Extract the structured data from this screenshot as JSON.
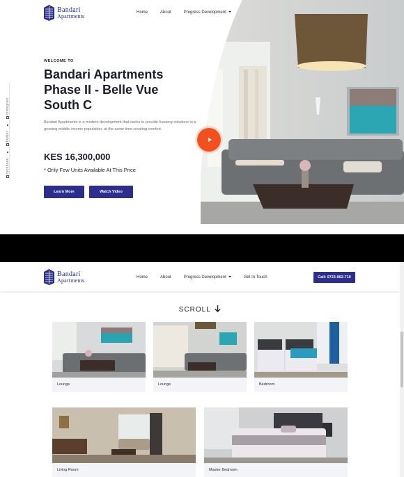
{
  "brand": {
    "line1": "Bandari",
    "line2": "Apartments"
  },
  "nav": {
    "home": "Home",
    "about": "About",
    "progress": "Progress Development",
    "contact": "Get In Touch",
    "call": "Call: 0723-962-710"
  },
  "social": {
    "instagram": "instagram",
    "twitter": "twitter",
    "facebook": "facebook"
  },
  "hero": {
    "welcome": "WELCOME TO",
    "title": "Bandari Apartments Phase II - Belle Vue South C",
    "description": "Bandari Apartments is a modern development that seeks to provide housing solutions to a growing middle income population, at the same time creating comfort.",
    "price": "KES 16,300,000",
    "price_note": "* Only Few Units Available At This Price",
    "learn_more": "Learn More",
    "watch_video": "Watch Video"
  },
  "gallery": {
    "scroll_label": "SCROLL",
    "cards": [
      {
        "label": "Lounge"
      },
      {
        "label": "Lounge"
      },
      {
        "label": "Bedroom"
      },
      {
        "label": "Living Room"
      },
      {
        "label": "Master Bedroom"
      }
    ]
  },
  "colors": {
    "brand_blue": "#2b2e8c",
    "accent_orange": "#f2511f",
    "text_dark": "#1b1d2a"
  }
}
